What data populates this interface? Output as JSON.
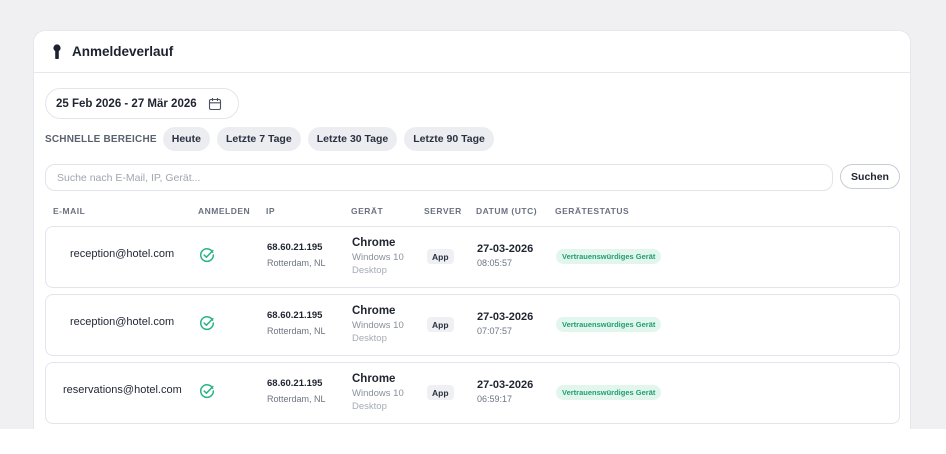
{
  "panel": {
    "title": "Anmeldeverlauf"
  },
  "filters": {
    "date_range": "25 Feb 2026 - 27 Mär 2026",
    "quick_label": "SCHNELLE BEREICHE",
    "quick_ranges": [
      "Heute",
      "Letzte 7 Tage",
      "Letzte 30 Tage",
      "Letzte 90 Tage"
    ]
  },
  "search": {
    "placeholder": "Suche nach E-Mail, IP, Gerät...",
    "value": "",
    "button_label": "Suchen"
  },
  "table": {
    "columns": [
      "E-MAIL",
      "ANMELDEN",
      "IP",
      "GERÄT",
      "SERVER",
      "DATUM (UTC)",
      "GERÄTESTATUS"
    ],
    "rows": [
      {
        "email": "reception@hotel.com",
        "login_status_icon": "check-circle-icon",
        "ip": "68.60.21.195",
        "location": "Rotterdam, NL",
        "browser": "Chrome",
        "os": "Windows 10",
        "device_type": "Desktop",
        "server": "App",
        "date": "27-03-2026",
        "time": "08:05:57",
        "status": "Vertrauenswürdiges Gerät"
      },
      {
        "email": "reception@hotel.com",
        "login_status_icon": "check-circle-icon",
        "ip": "68.60.21.195",
        "location": "Rotterdam, NL",
        "browser": "Chrome",
        "os": "Windows 10",
        "device_type": "Desktop",
        "server": "App",
        "date": "27-03-2026",
        "time": "07:07:57",
        "status": "Vertrauenswürdiges Gerät"
      },
      {
        "email": "reservations@hotel.com",
        "login_status_icon": "check-circle-icon",
        "ip": "68.60.21.195",
        "location": "Rotterdam, NL",
        "browser": "Chrome",
        "os": "Windows 10",
        "device_type": "Desktop",
        "server": "App",
        "date": "27-03-2026",
        "time": "06:59:17",
        "status": "Vertrauenswürdiges Gerät"
      }
    ]
  },
  "colors": {
    "success": "#2bb483",
    "badge_bg": "#e2f6ee",
    "badge_text": "#1f9e72"
  }
}
